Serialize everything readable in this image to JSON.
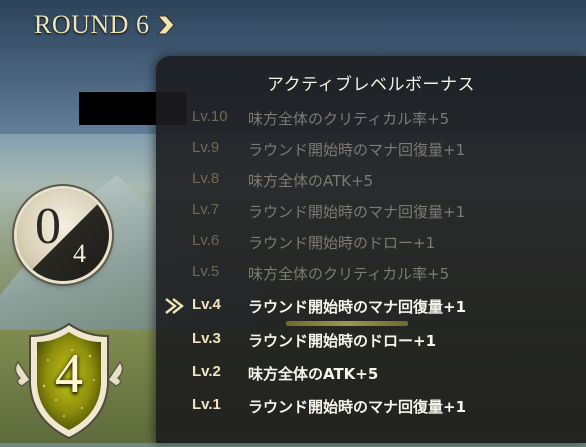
{
  "hud": {
    "round_label": "ROUND 6",
    "round_arrow_icon": "chevron-right-icon",
    "counter": {
      "current": "0",
      "max": "4"
    },
    "shield_value": "4"
  },
  "bonus_panel": {
    "title": "アクティブレベルボーナス",
    "current_level_index": 6,
    "rows": [
      {
        "level": "Lv.10",
        "text": "味方全体のクリティカル率+5",
        "active": false
      },
      {
        "level": "Lv.9",
        "text": "ラウンド開始時のマナ回復量+1",
        "active": false
      },
      {
        "level": "Lv.8",
        "text": "味方全体のATK+5",
        "active": false
      },
      {
        "level": "Lv.7",
        "text": "ラウンド開始時のマナ回復量+1",
        "active": false
      },
      {
        "level": "Lv.6",
        "text": "ラウンド開始時のドロー+1",
        "active": false
      },
      {
        "level": "Lv.5",
        "text": "味方全体のクリティカル率+5",
        "active": false
      },
      {
        "level": "Lv.4",
        "text": "ラウンド開始時のマナ回復量+1",
        "active": true
      },
      {
        "level": "Lv.3",
        "text": "ラウンド開始時のドロー+1",
        "active": true
      },
      {
        "level": "Lv.2",
        "text": "味方全体のATK+5",
        "active": true
      },
      {
        "level": "Lv.1",
        "text": "ラウンド開始時のマナ回復量+1",
        "active": true
      }
    ]
  },
  "colors": {
    "gold_text": "#efe4bd",
    "dim_text": "#7c7a73",
    "panel_bg": "#1c1c1e",
    "accent_arrow": "#f0e3b6"
  }
}
